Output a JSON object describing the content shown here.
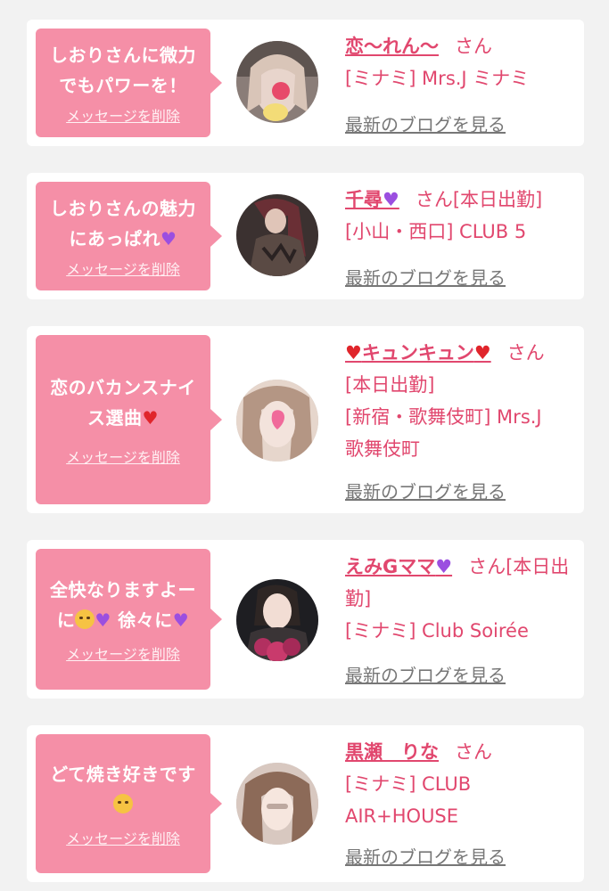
{
  "delete_label": "メッセージを削除",
  "blog_label": "最新のブログを見る",
  "honorific": "さん",
  "cards": [
    {
      "message": "しおりさんに微力\nでもパワーを！",
      "name": "恋〜れん〜",
      "name_suffix": "",
      "shop": "[ミナミ] Mrs.J ミナミ"
    },
    {
      "message": "しおりさんの魅力\nにあっぱれ",
      "message_emoji": "purple-heart",
      "name": "千尋",
      "name_emoji": "purple-heart",
      "name_suffix": "[本日出勤]",
      "shop": "[小山・西口] CLUB 5"
    },
    {
      "message": "恋のバカンスナイ\nス選曲",
      "message_emoji": "red-heart",
      "name": "キュンキュン",
      "name_emoji": "red-heart",
      "name_suffix": "[本日出勤]",
      "shop": "[新宿・歌舞伎町] Mrs.J\n歌舞伎町"
    },
    {
      "message": "全快なりますよー\nに",
      "message_tail": "徐々に",
      "message_emoji": "smiling-face-with-hearts",
      "name": "えみGママ",
      "name_emoji": "two-hearts",
      "name_suffix": "[本日出勤]",
      "shop": "[ミナミ] Club Soirée"
    },
    {
      "message": "どて焼き好きです",
      "message_emoji": "smiling-face-with-hearts",
      "name": "黒瀬　りな",
      "name_suffix": "",
      "shop": "[ミナミ] CLUB\nAIR+HOUSE"
    }
  ],
  "colors": {
    "accent": "#e1476e",
    "bubble": "#f58fa7",
    "background": "#f2f2f2"
  }
}
